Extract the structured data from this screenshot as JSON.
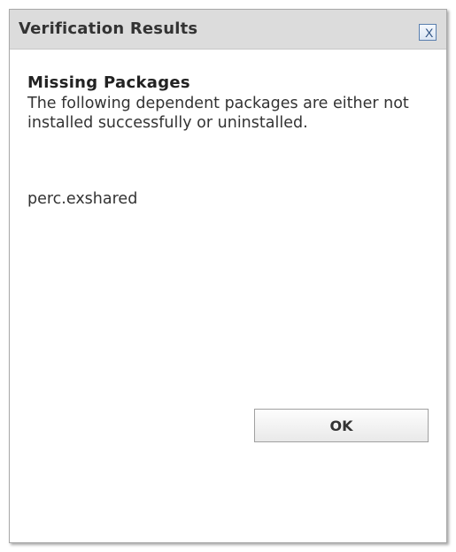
{
  "dialog": {
    "title": "Verification Results",
    "close_label": "X",
    "heading": "Missing Packages",
    "message": "The following dependent packages are either not installed successfully or uninstalled.",
    "packages": [
      "perc.exshared"
    ],
    "ok_label": "OK"
  }
}
